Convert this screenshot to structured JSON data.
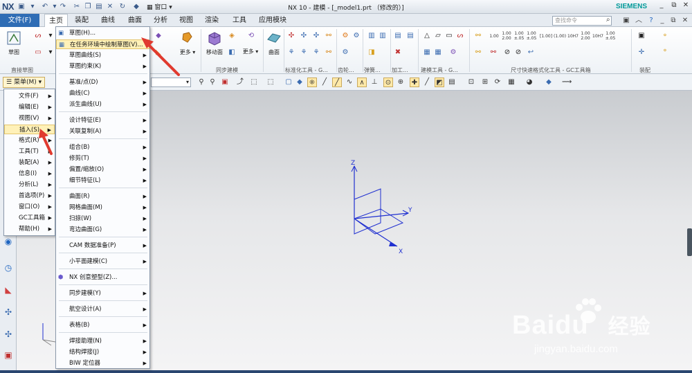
{
  "titlebar": {
    "logo": "NX",
    "window_menu": "窗口",
    "title": "NX 10 - 建模 - [_model1.prt （修改的）]",
    "brand": "SIEMENS",
    "controls": {
      "minimize": "_",
      "restore": "⧉",
      "close": "✕"
    }
  },
  "ribbon_tabs": {
    "file": "文件(F)",
    "tabs": [
      "主页",
      "装配",
      "曲线",
      "曲面",
      "分析",
      "视图",
      "渲染",
      "工具",
      "应用模块"
    ],
    "active_index": 0,
    "search_placeholder": "查找命令"
  },
  "ribbon": {
    "sketch_label": "草图",
    "more_label": "更多",
    "move_face_label": "移动面",
    "more2_label": "更多",
    "surface_label": "曲面",
    "more3_label": "更多",
    "groups": {
      "direct_sketch": "直接草图",
      "sync_modeling": "同步建模",
      "standard_tools": "标准化工具 - G...",
      "gear": "齿轮...",
      "spring": "弹簧...",
      "machining": "加工...",
      "modeling_tools": "建模工具 - G...",
      "dimension_tools": "尺寸快速格式化工具 - GC工具箱",
      "assembly": "装配"
    },
    "dim_buttons": [
      "1.00",
      "1.00\n2.00",
      "1.00\n±.05",
      "1.00\n±.05",
      "[1.00]",
      "(1.00)",
      "10H7",
      "1.00\n2.00",
      "10H7",
      "1.00\n±.05"
    ]
  },
  "toolbar2": {
    "menu_button": "菜单(M)",
    "filter_value": ""
  },
  "menu_level1": {
    "items": [
      {
        "label": "文件(F)",
        "arrow": true
      },
      {
        "label": "编辑(E)",
        "arrow": true
      },
      {
        "label": "视图(V)",
        "arrow": true
      },
      {
        "label": "插入(S)",
        "arrow": true,
        "highlighted": true
      },
      {
        "label": "格式(R)",
        "arrow": true
      },
      {
        "label": "工具(T)",
        "arrow": true
      },
      {
        "label": "装配(A)",
        "arrow": true
      },
      {
        "label": "信息(I)",
        "arrow": true
      },
      {
        "label": "分析(L)",
        "arrow": true
      },
      {
        "label": "首选项(P)",
        "arrow": true
      },
      {
        "label": "窗口(O)",
        "arrow": true
      },
      {
        "label": "GC工具箱",
        "arrow": true
      },
      {
        "label": "帮助(H)",
        "arrow": true
      }
    ]
  },
  "menu_level2": {
    "items": [
      {
        "label": "草图(H)...",
        "icon": "sketch-icon"
      },
      {
        "label": "在任务环境中绘制草图(V)...",
        "icon": "task-sketch-icon",
        "highlighted": true
      },
      {
        "label": "草图曲线(S)",
        "arrow": true
      },
      {
        "label": "草图约束(K)",
        "arrow": true
      },
      {
        "label": "基准/点(D)",
        "arrow": true
      },
      {
        "label": "曲线(C)",
        "arrow": true
      },
      {
        "label": "派生曲线(U)",
        "arrow": true
      },
      {
        "label": "设计特征(E)",
        "arrow": true
      },
      {
        "label": "关联复制(A)",
        "arrow": true
      },
      {
        "label": "组合(B)",
        "arrow": true
      },
      {
        "label": "修剪(T)",
        "arrow": true
      },
      {
        "label": "偏置/缩放(O)",
        "arrow": true
      },
      {
        "label": "细节特征(L)",
        "arrow": true
      },
      {
        "label": "曲面(R)",
        "arrow": true
      },
      {
        "label": "网格曲面(M)",
        "arrow": true
      },
      {
        "label": "扫掠(W)",
        "arrow": true
      },
      {
        "label": "弯边曲面(G)",
        "arrow": true
      },
      {
        "label": "CAM 数据准备(P)",
        "arrow": true
      },
      {
        "label": "小平面建模(C)",
        "arrow": true
      },
      {
        "label": "NX 创意塑型(Z)...",
        "icon": "realize-shape-icon"
      },
      {
        "label": "同步建模(Y)",
        "arrow": true
      },
      {
        "label": "航空设计(A)",
        "arrow": true
      },
      {
        "label": "表格(B)",
        "arrow": true
      },
      {
        "label": "焊接助理(N)",
        "arrow": true
      },
      {
        "label": "结构焊接(J)",
        "arrow": true
      },
      {
        "label": "BIW 定位器",
        "arrow": true
      }
    ]
  },
  "triad": {
    "x": "X",
    "y": "Y",
    "z": "Z"
  },
  "watermark": {
    "brand": "Baidu",
    "cn": "经验",
    "url": "jingyan.baidu.com"
  },
  "colors": {
    "accent": "#2f6db5",
    "highlight": "#fff1b8",
    "arrow": "#e03a2f",
    "triad": "#1f2fd0"
  }
}
